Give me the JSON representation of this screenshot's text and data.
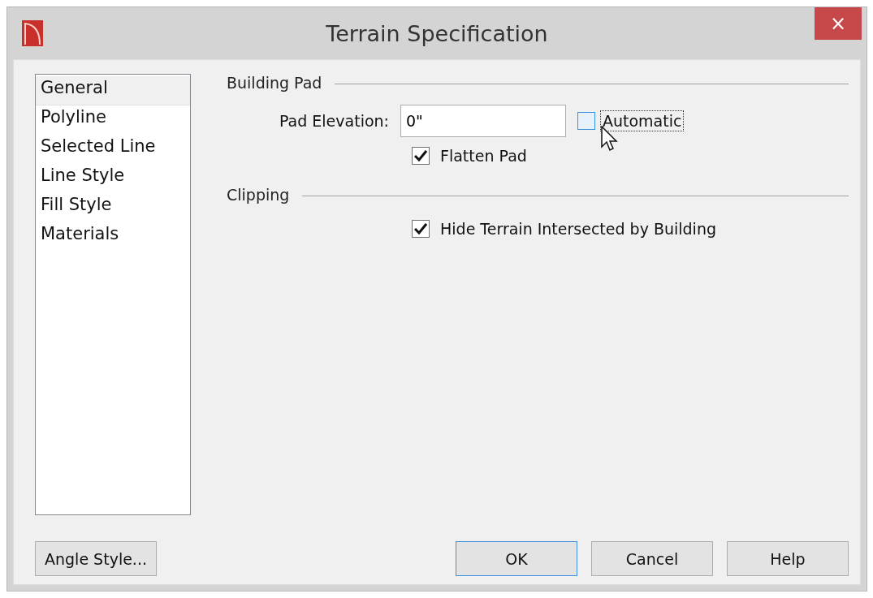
{
  "window": {
    "title": "Terrain Specification",
    "close": "×"
  },
  "sidebar": {
    "items": [
      {
        "label": "General",
        "selected": true
      },
      {
        "label": "Polyline",
        "selected": false
      },
      {
        "label": "Selected Line",
        "selected": false
      },
      {
        "label": "Line Style",
        "selected": false
      },
      {
        "label": "Fill Style",
        "selected": false
      },
      {
        "label": "Materials",
        "selected": false
      }
    ]
  },
  "sections": [
    {
      "title": "Building Pad",
      "field": {
        "label": "Pad Elevation:",
        "value": "0\""
      },
      "automatic": {
        "label": "Automatic",
        "checked": false,
        "focused": true
      },
      "checkboxes": [
        {
          "label": "Flatten Pad",
          "checked": true
        }
      ]
    },
    {
      "title": "Clipping",
      "checkboxes": [
        {
          "label": "Hide Terrain Intersected by Building",
          "checked": true
        }
      ]
    }
  ],
  "angle_button": "Angle Style...",
  "buttons": [
    {
      "label": "OK",
      "default": true
    },
    {
      "label": "Cancel",
      "default": false
    },
    {
      "label": "Help",
      "default": false
    }
  ]
}
